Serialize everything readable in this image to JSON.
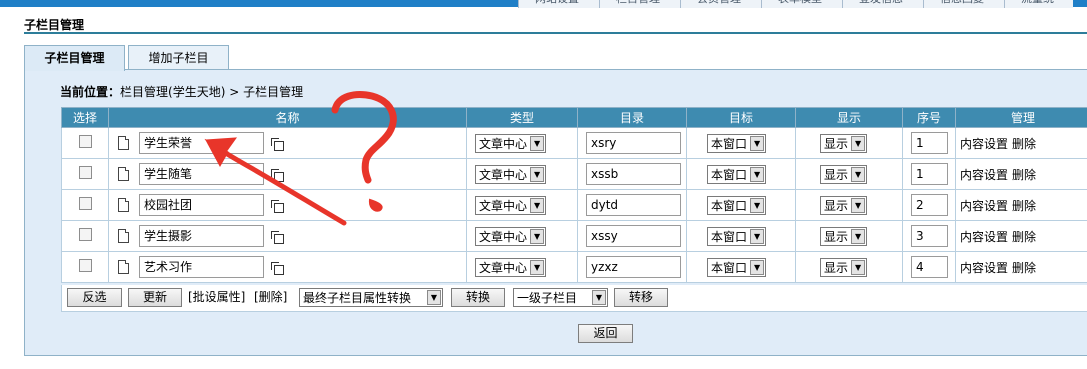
{
  "topnav": [
    "网站设置",
    "栏目管理",
    "会员管理",
    "表单模型",
    "登发信息",
    "信息回复",
    "流量统"
  ],
  "page_title": "子栏目管理",
  "tabs": [
    {
      "label": "子栏目管理",
      "active": true
    },
    {
      "label": "增加子栏目",
      "active": false
    }
  ],
  "breadcrumb": {
    "prefix": "当前位置：",
    "path": "栏目管理(学生天地) > 子栏目管理"
  },
  "columns": [
    "选择",
    "名称",
    "类型",
    "目录",
    "目标",
    "显示",
    "序号",
    "管理"
  ],
  "rows": [
    {
      "name": "学生荣誉",
      "type": "文章中心",
      "dir": "xsry",
      "target": "本窗口",
      "show": "显示",
      "seq": "1",
      "manage": [
        "内容设置",
        "删除"
      ]
    },
    {
      "name": "学生随笔",
      "type": "文章中心",
      "dir": "xssb",
      "target": "本窗口",
      "show": "显示",
      "seq": "1",
      "manage": [
        "内容设置",
        "删除"
      ]
    },
    {
      "name": "校园社团",
      "type": "文章中心",
      "dir": "dytd",
      "target": "本窗口",
      "show": "显示",
      "seq": "2",
      "manage": [
        "内容设置",
        "删除"
      ]
    },
    {
      "name": "学生摄影",
      "type": "文章中心",
      "dir": "xssy",
      "target": "本窗口",
      "show": "显示",
      "seq": "3",
      "manage": [
        "内容设置",
        "删除"
      ]
    },
    {
      "name": "艺术习作",
      "type": "文章中心",
      "dir": "yzxz",
      "target": "本窗口",
      "show": "显示",
      "seq": "4",
      "manage": [
        "内容设置",
        "删除"
      ]
    }
  ],
  "toolbar": {
    "invert": "反选",
    "update": "更新",
    "batch_attr": "[批设属性]",
    "delete": "[删除]",
    "convert_select": "最终子栏目属性转换",
    "convert_btn": "转换",
    "level_select": "一级子栏目",
    "move_btn": "转移"
  },
  "back_button": "返回",
  "annotation": {
    "stroke_color": "#e8352a"
  }
}
